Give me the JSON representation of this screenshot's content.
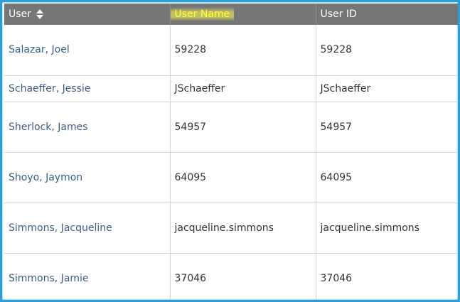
{
  "table": {
    "headers": {
      "user": "User",
      "user_name": "User Name",
      "user_id": "User ID"
    },
    "rows": [
      {
        "user": "Salazar, Joel",
        "user_name": "59228",
        "user_id": "59228"
      },
      {
        "user": "Schaeffer, Jessie",
        "user_name": "JSchaeffer",
        "user_id": "JSchaeffer"
      },
      {
        "user": "Sherlock, James",
        "user_name": "54957",
        "user_id": "54957"
      },
      {
        "user": "Shoyo, Jaymon",
        "user_name": "64095",
        "user_id": "64095"
      },
      {
        "user": "Simmons, Jacqueline",
        "user_name": "jacqueline.simmons",
        "user_id": "jacqueline.simmons"
      },
      {
        "user": "Simmons, Jamie",
        "user_name": "37046",
        "user_id": "37046"
      }
    ]
  },
  "icons": {
    "sort": "sort-icon"
  },
  "colors": {
    "frame": "#2a9fd8",
    "header_bg": "#767676",
    "highlight": "#ffff33",
    "link_text": "#3a5f8a"
  }
}
